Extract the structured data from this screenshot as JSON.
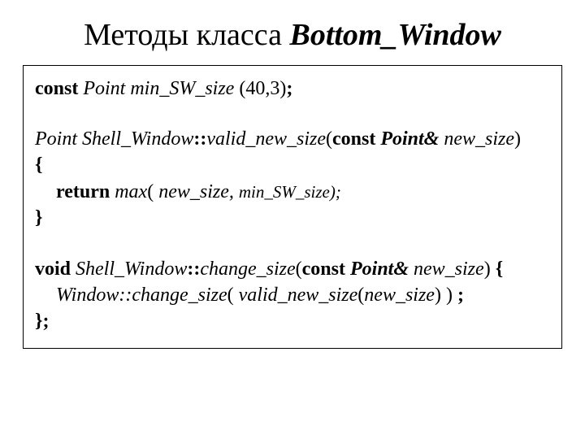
{
  "title": {
    "plain": "Методы класса ",
    "class_name": "Bottom_Window"
  },
  "code": {
    "l1": {
      "kw_const": "const",
      "sp1": " ",
      "type": "Point",
      "sp2": " ",
      "name": "min_SW_size",
      "args": " (40,3)",
      "semi": ";"
    },
    "l2": {
      "type": "Point",
      "sp1": " ",
      "cls": "Shell_Window",
      "dcolon": "::",
      "fn": "valid_new_size",
      "lp": "(",
      "kw_const": "const",
      "sp2": " ",
      "ptype": "Point&",
      "sp3": " ",
      "pname": "new_size",
      "rp": ")"
    },
    "l2b": {
      "brace": "{"
    },
    "l3": {
      "kw_return": "return",
      "sp1": " ",
      "fn": "max",
      "lp": "(",
      "sp2": " ",
      "a1": "new_size",
      "comma": ",",
      "sp3": " ",
      "a2": "min_SW_size",
      "rp_semi": ");"
    },
    "l3b": {
      "brace": "}"
    },
    "l4": {
      "kw_void": "void",
      "sp1": " ",
      "cls": "Shell_Window",
      "dcolon": "::",
      "fn": "change_size",
      "lp": "(",
      "kw_const": "const",
      "sp2": " ",
      "ptype": "Point&",
      "sp3": " ",
      "pname": "new_size",
      "rp": ")",
      "sp4": " ",
      "brace": "{"
    },
    "l5": {
      "call1": "Window::change_size",
      "lp": "(",
      "sp1": " ",
      "fn": "valid_new_size",
      "lp2": "(",
      "arg": "new_size",
      "rp2": ")",
      "sp2": " ",
      "rp": ")",
      "sp3": " ",
      "semi": ";"
    },
    "l6": {
      "brace_semi": "};"
    }
  }
}
